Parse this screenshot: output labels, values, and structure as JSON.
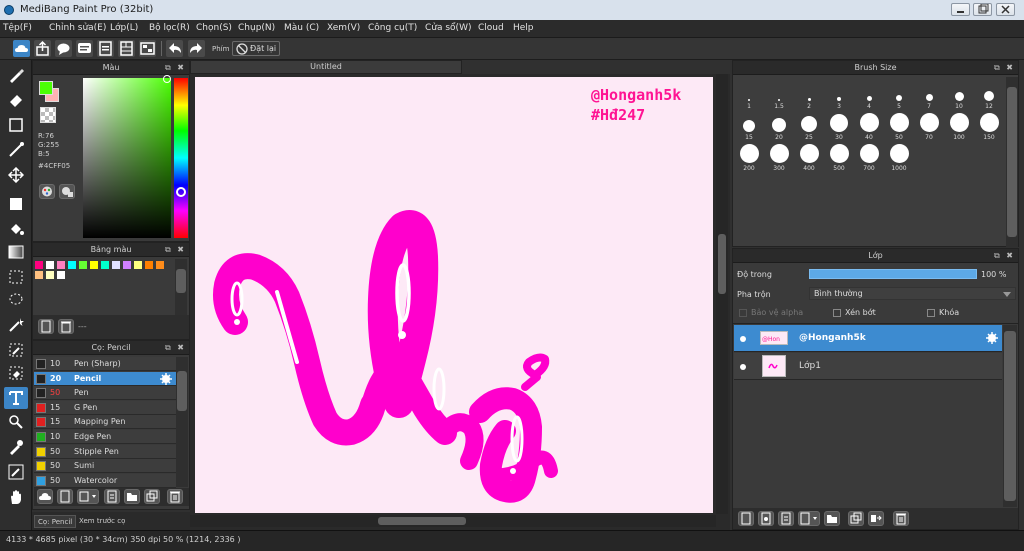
{
  "window": {
    "title": "MediBang Paint Pro (32bit)"
  },
  "menu": [
    "Tệp(F)",
    "Chỉnh sửa(E)",
    "Lớp(L)",
    "Bộ lọc(R)",
    "Chọn(S)",
    "Chụp(N)",
    "Màu (C)",
    "Xem(V)",
    "Công cụ(T)",
    "Cửa sổ(W)",
    "Cloud",
    "Help"
  ],
  "toolbar": {
    "shortcut_label": "Phím",
    "reset_label": "Đặt lại"
  },
  "color_panel": {
    "title": "Màu",
    "r": "R:76",
    "g": "G:255",
    "b": "B:5",
    "hex": "#4CFF05",
    "fg_color": "#4CFF05",
    "bg_color": "#FFB3B3"
  },
  "palette_panel": {
    "title": "Bảng màu",
    "footer_text": "---",
    "colors": [
      "#ff007f",
      "#ffffff",
      "#ff80c0",
      "#00ffff",
      "#66ff33",
      "#ffff00",
      "#00ffcc",
      "#e0e0ff",
      "#d080ff",
      "#ffff80",
      "#ff8000",
      "#ff8c1a",
      "#ffc080",
      "#ffffc0",
      "#ffffff"
    ]
  },
  "brush_panel": {
    "title": "Cọ: Pencil",
    "brushes": [
      {
        "size": "10",
        "name": "Pen (Sharp)",
        "swatch": "#222222",
        "size_color": "#dcdcdc"
      },
      {
        "size": "20",
        "name": "Pencil",
        "swatch": "#222222",
        "size_color": "#ffffff",
        "selected": true
      },
      {
        "size": "50",
        "name": "Pen",
        "swatch": "#222222",
        "size_color": "#ff4040"
      },
      {
        "size": "15",
        "name": "G Pen",
        "swatch": "#e02020",
        "size_color": "#dcdcdc"
      },
      {
        "size": "15",
        "name": "Mapping Pen",
        "swatch": "#e02020",
        "size_color": "#dcdcdc"
      },
      {
        "size": "10",
        "name": "Edge Pen",
        "swatch": "#20b020",
        "size_color": "#dcdcdc"
      },
      {
        "size": "50",
        "name": "Stipple Pen",
        "swatch": "#f0d000",
        "size_color": "#dcdcdc"
      },
      {
        "size": "50",
        "name": "Sumi",
        "swatch": "#f0d000",
        "size_color": "#dcdcdc"
      },
      {
        "size": "50",
        "name": "Watercolor",
        "swatch": "#30a0e0",
        "size_color": "#dcdcdc"
      }
    ]
  },
  "panel_tabs": [
    "Cọ: Pencil",
    "Xem trước cọ"
  ],
  "canvas": {
    "tab_title": "Untitled",
    "watermark_line1": "@Honganh5k",
    "watermark_line2": "#Hđ247",
    "bg_color": "#FDE9F6",
    "ink_color": "#FF00CC"
  },
  "brush_size_panel": {
    "title": "Brush Size",
    "sizes": [
      "1",
      "1.5",
      "2",
      "3",
      "4",
      "5",
      "7",
      "10",
      "12",
      "15",
      "20",
      "25",
      "30",
      "40",
      "50",
      "70",
      "100",
      "150",
      "200",
      "300",
      "400",
      "500",
      "700",
      "1000"
    ]
  },
  "layer_panel": {
    "title": "Lớp",
    "opacity_label": "Độ trong",
    "opacity_value": "100 %",
    "opacity": 1.0,
    "blend_label": "Pha trộn",
    "blend_value": "Bình thường",
    "protect_alpha": "Bảo vệ alpha",
    "clipping": "Xén bớt",
    "lock": "Khóa",
    "layers": [
      {
        "name": "@Honganh5k",
        "selected": true
      },
      {
        "name": "Lớp1",
        "selected": false
      }
    ]
  },
  "status_bar": {
    "text": "4133 * 4685 pixel  (30 * 34cm)  350 dpi  50 %  (1214, 2336 )"
  }
}
